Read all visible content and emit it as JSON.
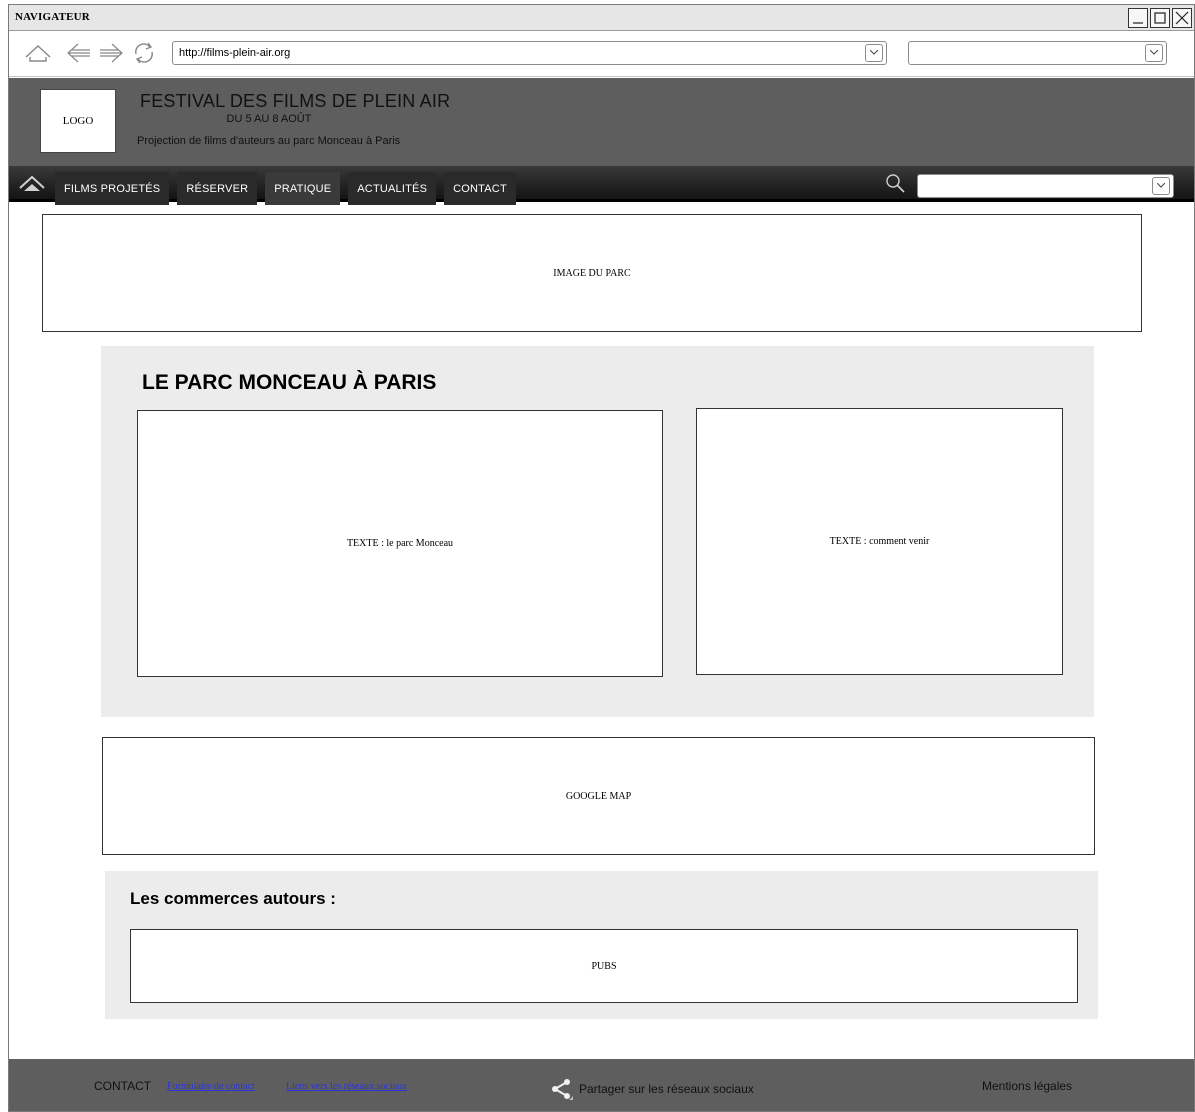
{
  "browser": {
    "title": "NAVIGATEUR",
    "url": "http://films-plein-air.org",
    "search_value": ""
  },
  "header": {
    "logo": "LOGO",
    "title": "FESTIVAL DES FILMS DE PLEIN AIR",
    "dates": "DU 5 AU 8 AOÛT",
    "subtitle": "Projection de films d'auteurs au parc Monceau à Paris"
  },
  "nav": {
    "items": [
      {
        "label": "FILMS PROJETÉS"
      },
      {
        "label": "RÉSERVER"
      },
      {
        "label": "PRATIQUE"
      },
      {
        "label": "ACTUALITÉS"
      },
      {
        "label": "CONTACT"
      }
    ],
    "search_value": ""
  },
  "main": {
    "hero_image": "IMAGE DU PARC",
    "section_title": "LE PARC MONCEAU À PARIS",
    "text_left": "TEXTE : le parc Monceau",
    "text_right": "TEXTE : comment venir",
    "map": "GOOGLE MAP",
    "shops_title": "Les commerces autours :",
    "ads": "PUBS"
  },
  "footer": {
    "contact": "CONTACT",
    "contact_form_link": "Formulaire de contact",
    "social_links": "Liens vers les réseaux sociaux",
    "share": "Partager sur les réseaux sociaux",
    "legal": "Mentions légales"
  },
  "colors": {
    "header_bg": "#5e5e5e",
    "nav_bg": "#222222",
    "panel_bg": "#ececec",
    "link": "#2b35d8"
  }
}
